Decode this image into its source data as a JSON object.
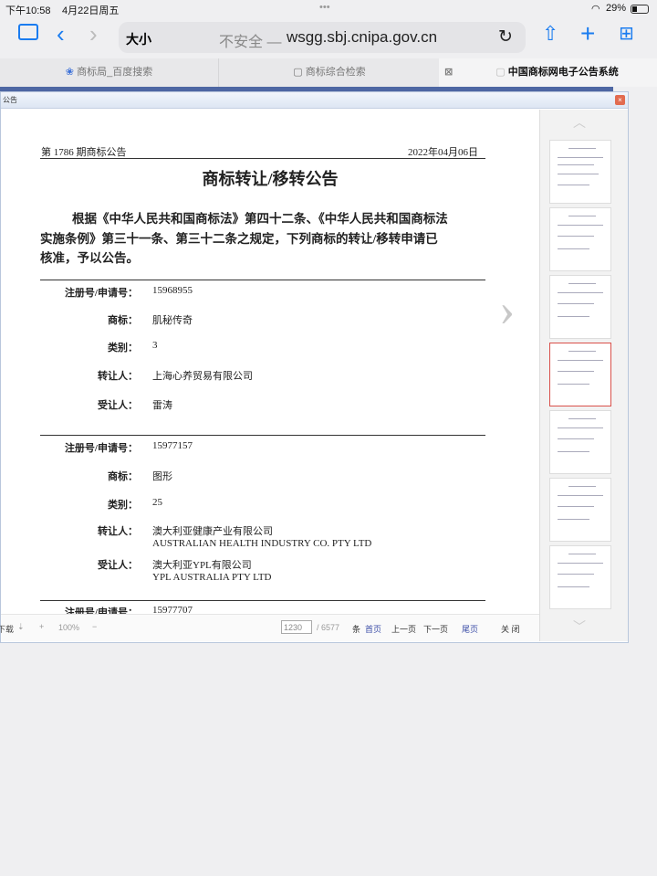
{
  "status": {
    "time": "下午10:58",
    "date": "4月22日周五",
    "dots": "•••",
    "battery": "29%"
  },
  "browser": {
    "text_size": "大小",
    "insecure": "不安全 —",
    "domain": "wsgg.sbj.cnipa.gov.cn"
  },
  "tabs": [
    {
      "label": "商标局_百度搜索"
    },
    {
      "label": "商标综合检索"
    },
    {
      "label": "中国商标网电子公告系统"
    }
  ],
  "dialog": {
    "title": "公告",
    "close": "×"
  },
  "doc": {
    "issue": "第 1786 期商标公告",
    "date": "2022年04月06日",
    "title": "商标转让/移转公告",
    "para": [
      "根据《中华人民共和国商标法》第四十二条、《中华人民共和国商标法",
      "实施条例》第三十一条、第三十二条之规定，下列商标的转让/移转申请已",
      "核准，予以公告。"
    ],
    "labels": {
      "reg": "注册号/申请号：",
      "mark": "商标：",
      "cls": "类别：",
      "from": "转让人：",
      "to": "受让人："
    },
    "records": [
      {
        "reg": "15968955",
        "mark": "肌秘传奇",
        "cls": "3",
        "from": [
          "上海心养贸易有限公司"
        ],
        "to": [
          "雷涛"
        ]
      },
      {
        "reg": "15977157",
        "mark": "图形",
        "cls": "25",
        "from": [
          "澳大利亚健康产业有限公司",
          "AUSTRALIAN HEALTH INDUSTRY CO. PTY LTD"
        ],
        "to": [
          "澳大利亚YPL有限公司",
          "YPL AUSTRALIA PTY LTD"
        ]
      }
    ],
    "next_reg": "15977707"
  },
  "footer": {
    "download": "下载",
    "zoom": "100%",
    "page": "1230",
    "total": "/ 6577",
    "unit": "条",
    "first": "首页",
    "prev": "上一页",
    "next": "下一页",
    "last": "尾页",
    "close": "关 闭"
  }
}
